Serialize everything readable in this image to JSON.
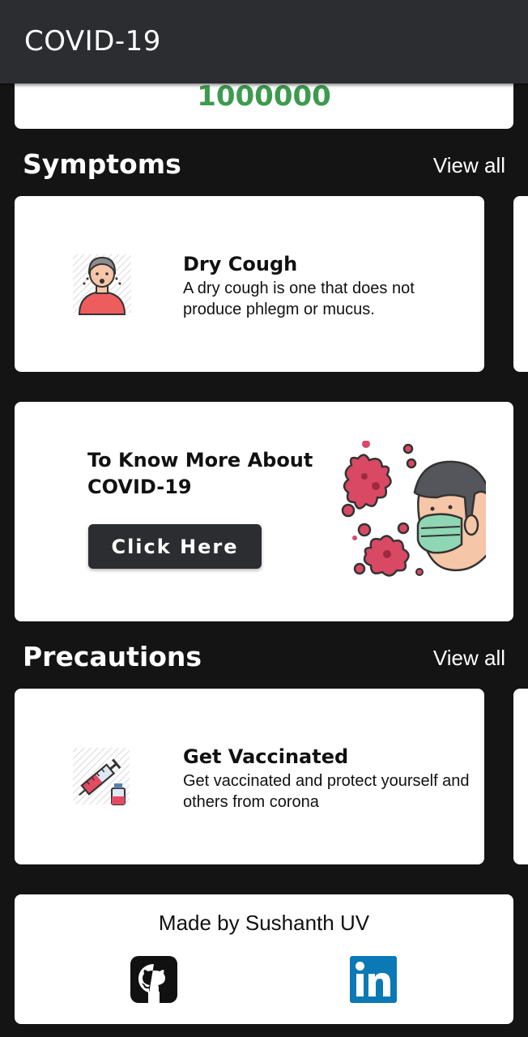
{
  "app_bar": {
    "title": "COVID-19"
  },
  "stat": {
    "value": "1000000"
  },
  "symptoms": {
    "title": "Symptoms",
    "view_all": "View all",
    "items": [
      {
        "title": "Dry Cough",
        "description": "A dry cough is one that does not produce phlegm or mucus.",
        "icon": "coughing-person-icon"
      }
    ]
  },
  "promo": {
    "text": "To Know More About COVID-19",
    "button": "Click Here",
    "icon": "masked-person-virus-icon"
  },
  "precautions": {
    "title": "Precautions",
    "view_all": "View all",
    "items": [
      {
        "title": "Get Vaccinated",
        "description": "Get vaccinated and protect yourself and others from corona",
        "icon": "vaccine-syringe-icon"
      }
    ]
  },
  "footer": {
    "credit": "Made by Sushanth UV",
    "links": [
      {
        "icon": "github-icon"
      },
      {
        "icon": "linkedin-icon"
      }
    ]
  },
  "colors": {
    "background": "#141414",
    "app_bar": "#2b2d31",
    "stat_green": "#3d9a4f",
    "button": "#2b2d31"
  }
}
